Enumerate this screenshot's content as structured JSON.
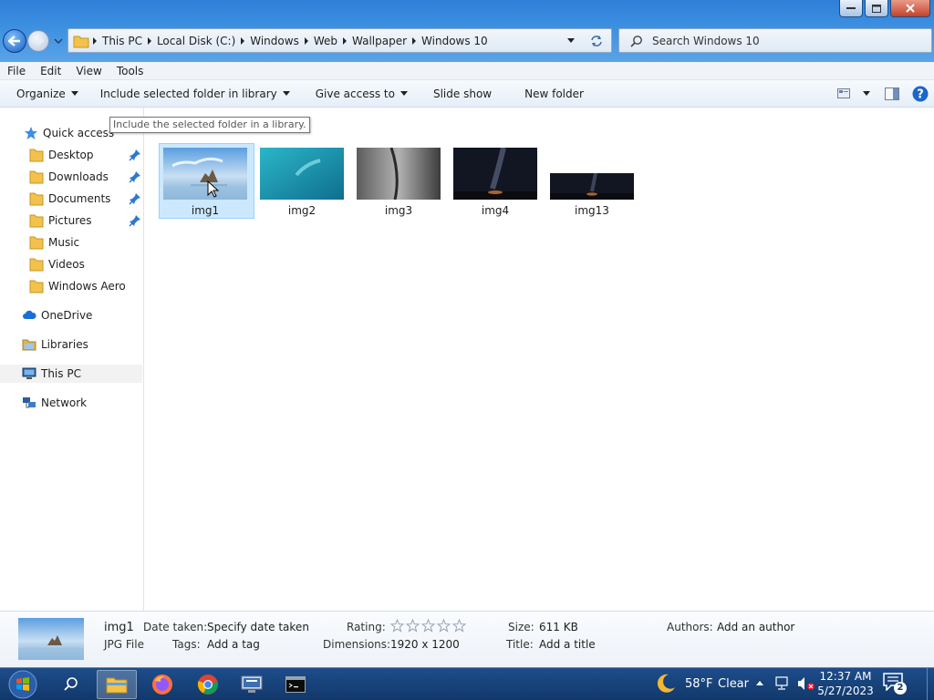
{
  "window": {
    "minimize_icon": "minimize-icon",
    "maximize_icon": "maximize-icon",
    "close_icon": "close-icon"
  },
  "address": {
    "crumbs": [
      "This PC",
      "Local Disk (C:)",
      "Windows",
      "Web",
      "Wallpaper",
      "Windows 10"
    ]
  },
  "search": {
    "placeholder": "Search Windows 10"
  },
  "menubar": {
    "file": "File",
    "edit": "Edit",
    "view": "View",
    "tools": "Tools"
  },
  "toolbar": {
    "organize": "Organize",
    "include": "Include selected folder in library",
    "give_access": "Give access to",
    "slide_show": "Slide show",
    "new_folder": "New folder"
  },
  "tooltip": "Include the selected folder in a library.",
  "nav": {
    "quick_access": "Quick access",
    "desktop": "Desktop",
    "downloads": "Downloads",
    "documents": "Documents",
    "pictures": "Pictures",
    "music": "Music",
    "videos": "Videos",
    "windows_aero": "Windows Aero",
    "onedrive": "OneDrive",
    "libraries": "Libraries",
    "this_pc": "This PC",
    "network": "Network"
  },
  "files": [
    {
      "name": "img1",
      "selected": true
    },
    {
      "name": "img2",
      "selected": false
    },
    {
      "name": "img3",
      "selected": false
    },
    {
      "name": "img4",
      "selected": false
    },
    {
      "name": "img13",
      "selected": false
    }
  ],
  "details": {
    "name": "img1",
    "type": "JPG File",
    "date_taken_label": "Date taken:",
    "date_taken": "Specify date taken",
    "tags_label": "Tags:",
    "tags": "Add a tag",
    "rating_label": "Rating:",
    "rating": 0,
    "dimensions_label": "Dimensions:",
    "dimensions": "1920 x 1200",
    "size_label": "Size:",
    "size": "611 KB",
    "title_label": "Title:",
    "title": "Add a title",
    "authors_label": "Authors:",
    "authors": "Add an author"
  },
  "taskbar": {
    "weather_temp": "58°F",
    "weather_desc": "Clear",
    "time": "12:37 AM",
    "date": "5/27/2023",
    "notification_count": "2"
  }
}
